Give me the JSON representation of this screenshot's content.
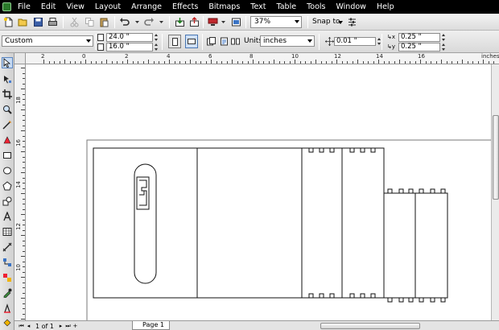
{
  "menu": [
    "File",
    "Edit",
    "View",
    "Layout",
    "Arrange",
    "Effects",
    "Bitmaps",
    "Text",
    "Table",
    "Tools",
    "Window",
    "Help"
  ],
  "toolbar": {
    "zoom_value": "37%",
    "snap_label": "Snap to"
  },
  "property_bar": {
    "preset": "Custom",
    "width": "24.0 \"",
    "height": "16.0 \"",
    "units_label": "Units:",
    "units_value": "inches",
    "nudge": "0.01 \"",
    "dup_x": "0.25 \"",
    "dup_y": "0.25 \""
  },
  "rulers": {
    "h_labels": [
      "2",
      "0",
      "2",
      "4",
      "6",
      "8",
      "10",
      "12",
      "14",
      "16",
      "inches"
    ],
    "v_labels": [
      "18",
      "16",
      "14",
      "12",
      "10"
    ]
  },
  "status": {
    "page_of": "1 of 1",
    "page_tab": "Page 1"
  },
  "toolbox_icons": [
    "pick-tool-icon",
    "shape-tool-icon",
    "crop-tool-icon",
    "zoom-tool-icon",
    "freehand-tool-icon",
    "smart-fill-icon",
    "rectangle-tool-icon",
    "ellipse-tool-icon",
    "polygon-tool-icon",
    "basic-shapes-icon",
    "text-tool-icon",
    "table-tool-icon",
    "dimension-tool-icon",
    "connector-tool-icon",
    "blend-tool-icon",
    "eyedropper-tool-icon",
    "outline-tool-icon",
    "fill-tool-icon"
  ],
  "colors": {
    "menubar_bg": "#000000",
    "canvas_bg": "#ffffff",
    "ui_bg": "#d6d6d6"
  }
}
